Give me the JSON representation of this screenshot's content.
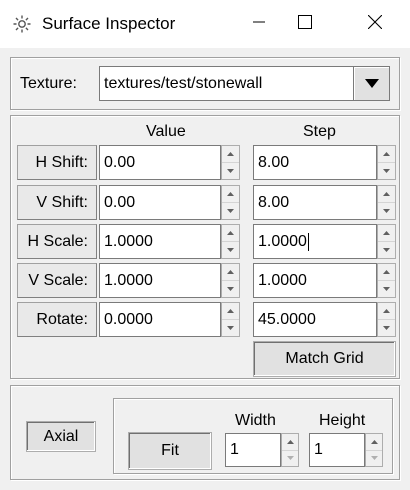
{
  "window": {
    "title": "Surface Inspector",
    "app_icon": "gear-icon",
    "controls": [
      "minimize-icon",
      "maximize-icon",
      "close-icon"
    ]
  },
  "texture": {
    "label": "Texture:",
    "value": "textures/test/stonewall"
  },
  "transform": {
    "header_value": "Value",
    "header_step": "Step",
    "rows": [
      {
        "label": "H Shift:",
        "value": "0.00",
        "step": "8.00"
      },
      {
        "label": "V Shift:",
        "value": "0.00",
        "step": "8.00"
      },
      {
        "label": "H Scale:",
        "value": "1.0000",
        "step": "1.0000"
      },
      {
        "label": "V Scale:",
        "value": "1.0000",
        "step": "1.0000"
      },
      {
        "label": "Rotate:",
        "value": "0.0000",
        "step": "45.0000"
      }
    ],
    "match_grid_label": "Match Grid"
  },
  "fit": {
    "axial_label": "Axial",
    "fit_label": "Fit",
    "width_label": "Width",
    "height_label": "Height",
    "width_value": "1",
    "height_value": "1"
  }
}
